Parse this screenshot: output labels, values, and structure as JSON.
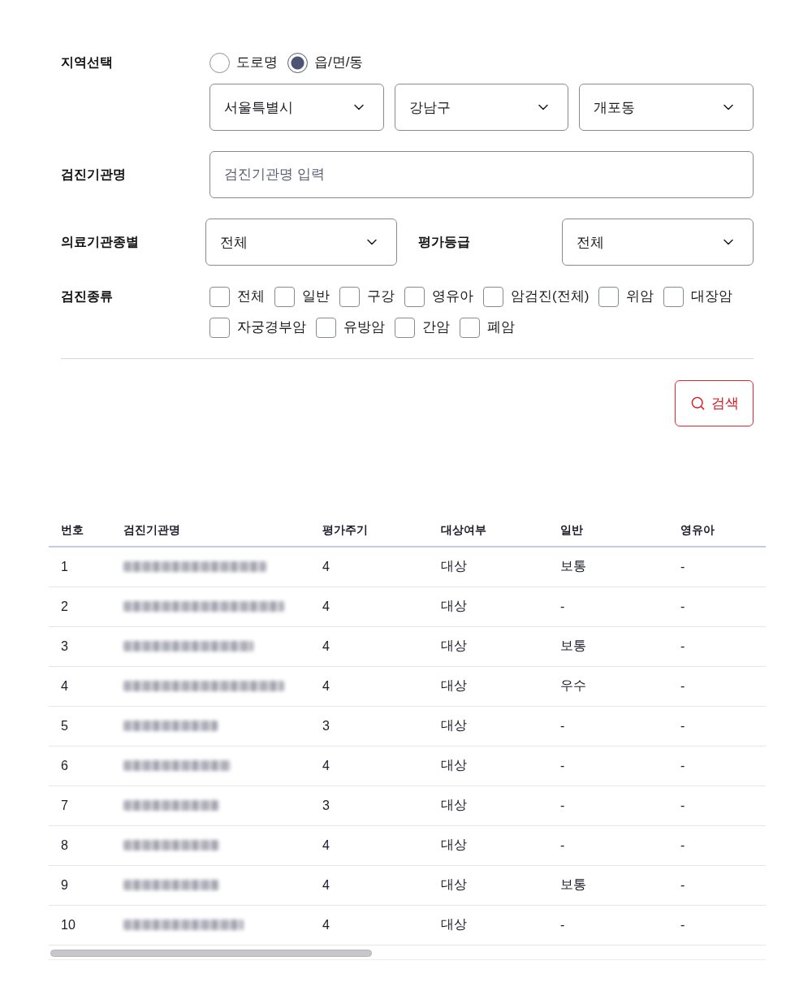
{
  "region": {
    "label": "지역선택",
    "radios": [
      {
        "label": "도로명",
        "selected": false
      },
      {
        "label": "읍/면/동",
        "selected": true
      }
    ],
    "selects": [
      {
        "value": "서울특별시"
      },
      {
        "value": "강남구"
      },
      {
        "value": "개포동"
      }
    ]
  },
  "institution_name": {
    "label": "검진기관명",
    "placeholder": "검진기관명 입력"
  },
  "institution_type": {
    "label": "의료기관종별",
    "value": "전체"
  },
  "grade": {
    "label": "평가등급",
    "value": "전체"
  },
  "checkup_types": {
    "label": "검진종류",
    "options": [
      {
        "label": "전체",
        "checked": false
      },
      {
        "label": "일반",
        "checked": false
      },
      {
        "label": "구강",
        "checked": false
      },
      {
        "label": "영유아",
        "checked": false
      },
      {
        "label": "암검진(전체)",
        "checked": false
      },
      {
        "label": "위암",
        "checked": false
      },
      {
        "label": "대장암",
        "checked": false
      },
      {
        "label": "자궁경부암",
        "checked": false
      },
      {
        "label": "유방암",
        "checked": false
      },
      {
        "label": "간암",
        "checked": false
      },
      {
        "label": "폐암",
        "checked": false
      }
    ]
  },
  "search_button": {
    "label": "검색"
  },
  "table": {
    "columns": [
      "번호",
      "검진기관명",
      "평가주기",
      "대상여부",
      "일반",
      "영유아"
    ],
    "rows": [
      {
        "number": "1",
        "name_blurred": true,
        "cycle": "4",
        "target": "대상",
        "general": "보통",
        "infant": "-"
      },
      {
        "number": "2",
        "name_blurred": true,
        "cycle": "4",
        "target": "대상",
        "general": "-",
        "infant": "-"
      },
      {
        "number": "3",
        "name_blurred": true,
        "cycle": "4",
        "target": "대상",
        "general": "보통",
        "infant": "-"
      },
      {
        "number": "4",
        "name_blurred": true,
        "cycle": "4",
        "target": "대상",
        "general": "우수",
        "infant": "-"
      },
      {
        "number": "5",
        "name_blurred": true,
        "cycle": "3",
        "target": "대상",
        "general": "-",
        "infant": "-"
      },
      {
        "number": "6",
        "name_blurred": true,
        "cycle": "4",
        "target": "대상",
        "general": "-",
        "infant": "-"
      },
      {
        "number": "7",
        "name_blurred": true,
        "cycle": "3",
        "target": "대상",
        "general": "-",
        "infant": "-"
      },
      {
        "number": "8",
        "name_blurred": true,
        "cycle": "4",
        "target": "대상",
        "general": "-",
        "infant": "-"
      },
      {
        "number": "9",
        "name_blurred": true,
        "cycle": "4",
        "target": "대상",
        "general": "보통",
        "infant": "-"
      },
      {
        "number": "10",
        "name_blurred": true,
        "cycle": "4",
        "target": "대상",
        "general": "-",
        "infant": "-"
      }
    ]
  }
}
